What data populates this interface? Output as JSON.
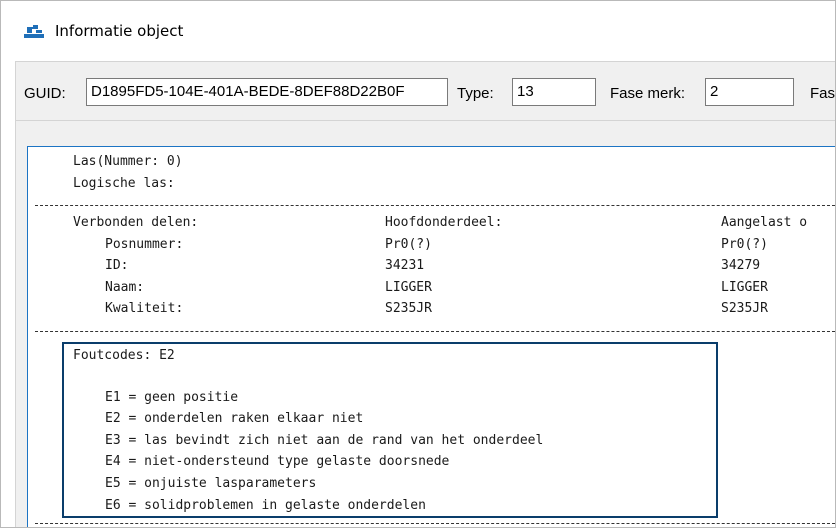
{
  "window": {
    "title": "Informatie object"
  },
  "topbar": {
    "guid_label": "GUID:",
    "guid_value": "D1895FD5-104E-401A-BEDE-8DEF88D22B0F",
    "type_label": "Type:",
    "type_value": "13",
    "fase_merk_label": "Fase merk:",
    "fase_merk_value": "2",
    "truncated_label": "Fas"
  },
  "report": {
    "las_line": "Las(Nummer: 0)",
    "logische_las": "Logische las:",
    "verbonden_delen": "Verbonden delen:",
    "hoofdonderdeel": "Hoofdonderdeel:",
    "aangelast": "Aangelast o",
    "rows": [
      {
        "label": "Posnummer:",
        "main": "Pr0(?)",
        "secondary": "Pr0(?)"
      },
      {
        "label": "ID:",
        "main": "34231",
        "secondary": "34279"
      },
      {
        "label": "Naam:",
        "main": "LIGGER",
        "secondary": "LIGGER"
      },
      {
        "label": "Kwaliteit:",
        "main": "S235JR",
        "secondary": "S235JR"
      }
    ],
    "foutcodes": "Foutcodes: E2",
    "codes": [
      "E1 = geen positie",
      "E2 = onderdelen raken elkaar niet",
      "E3 = las bevindt zich niet aan de rand van het onderdeel",
      "E4 = niet-ondersteund type gelaste doorsnede",
      "E5 = onjuiste lasparameters",
      "E6 = solidproblemen in gelaste onderdelen"
    ]
  },
  "colors": {
    "highlight_border": "#0a3d6b",
    "view_border": "#1c74c4",
    "panel_bg": "#f0f0f0"
  },
  "icons": {
    "app": "tekla-object-icon"
  }
}
